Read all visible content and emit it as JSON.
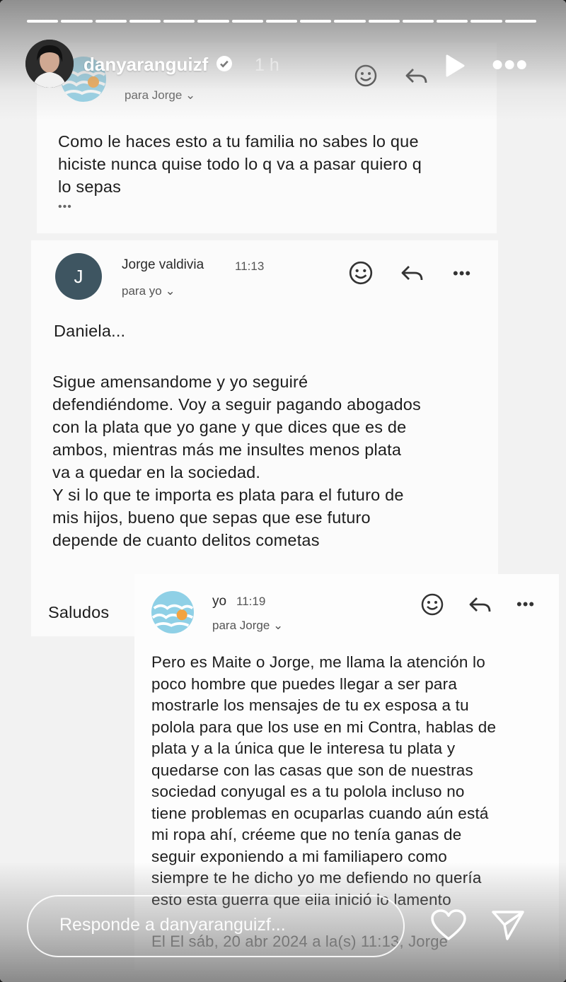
{
  "story": {
    "username": "danyaranguizf",
    "posted": "1 h",
    "progress_segments": 15,
    "reply_placeholder": "Responde a danyaranguizf..."
  },
  "email1": {
    "recipient": "para Jorge",
    "body": [
      "Como le haces esto a tu familia no sabes lo que",
      "hiciste nunca quise todo lo q va a pasar quiero q",
      "lo sepas"
    ],
    "more": "•••"
  },
  "email2": {
    "avatar_letter": "J",
    "sender": "Jorge valdivia",
    "time": "11:13",
    "recipient": "para yo",
    "greeting": "Daniela...",
    "body": [
      "Sigue amensandome y yo seguiré",
      "defendiéndome. Voy a seguir pagando abogados",
      "con la plata que yo gane y que dices que es de",
      "ambos, mientras más me insultes menos plata",
      "va a quedar en la sociedad.",
      "Y si lo que te importa es plata para el futuro de",
      "mis hijos, bueno que sepas que ese futuro",
      "depende de cuanto delitos cometas"
    ],
    "signoff": "Saludos"
  },
  "email3": {
    "sender": "yo",
    "time": "11:19",
    "recipient": "para Jorge",
    "body": [
      "Pero es Maite o Jorge, me llama la atención lo",
      "poco hombre que puedes llegar a ser para",
      "mostrarle los mensajes de tu ex esposa a tu",
      "polola para que los use en mi Contra, hablas de",
      "plata y a la única que le interesa tu plata y",
      "quedarse con las casas que son de nuestras",
      "sociedad conyugal es a tu polola incluso no",
      "tiene problemas en ocuparlas cuando aún está",
      "mi ropa ahí, créeme que no tenía ganas de",
      "seguir exponiendo a mi familiapero como",
      "siempre te he dicho yo me defiendo no quería",
      "esto esta guerra que ella inició lo lamento"
    ],
    "quote": "El El sáb, 20 abr 2024 a la(s) 11:13, Jorge"
  },
  "icons": [
    "verified-badge-icon",
    "play-icon",
    "more-icon",
    "emoji-icon",
    "reply-icon",
    "heart-icon",
    "send-icon"
  ]
}
